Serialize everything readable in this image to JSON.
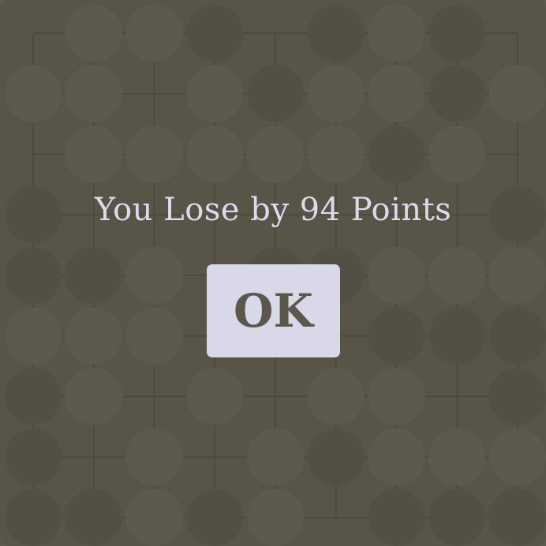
{
  "dialog": {
    "message": "You Lose by 94 Points",
    "ok_label": "OK"
  },
  "board": {
    "size": 9,
    "stones": [
      [
        ".",
        "w",
        "w",
        "b",
        ".",
        "b",
        "w",
        "b",
        "."
      ],
      [
        "w",
        "w",
        ".",
        "w",
        "b",
        "w",
        "w",
        "b",
        "w"
      ],
      [
        ".",
        "w",
        "w",
        "w",
        "w",
        "w",
        "b",
        "w",
        "."
      ],
      [
        "b",
        ".",
        ".",
        ".",
        ".",
        ".",
        ".",
        ".",
        "b"
      ],
      [
        "b",
        "b",
        "w",
        ".",
        "b",
        "b",
        "w",
        "w",
        "w"
      ],
      [
        "w",
        "w",
        "w",
        ".",
        ".",
        ".",
        "b",
        "b",
        "b"
      ],
      [
        "b",
        "w",
        ".",
        "w",
        ".",
        "w",
        "w",
        ".",
        "b"
      ],
      [
        "b",
        ".",
        "w",
        ".",
        "w",
        "b",
        "w",
        "w",
        "w"
      ],
      [
        "b",
        "b",
        "w",
        "b",
        "w",
        ".",
        "b",
        "b",
        "b"
      ]
    ]
  },
  "colors": {
    "board": "#6b6659",
    "grid_line": "#4a4740",
    "black_stone": "#5a5750",
    "white_stone": "#74716b",
    "overlay_text": "#dcdaeb",
    "button_bg": "#d9d8e8",
    "button_text": "#5b574c"
  }
}
